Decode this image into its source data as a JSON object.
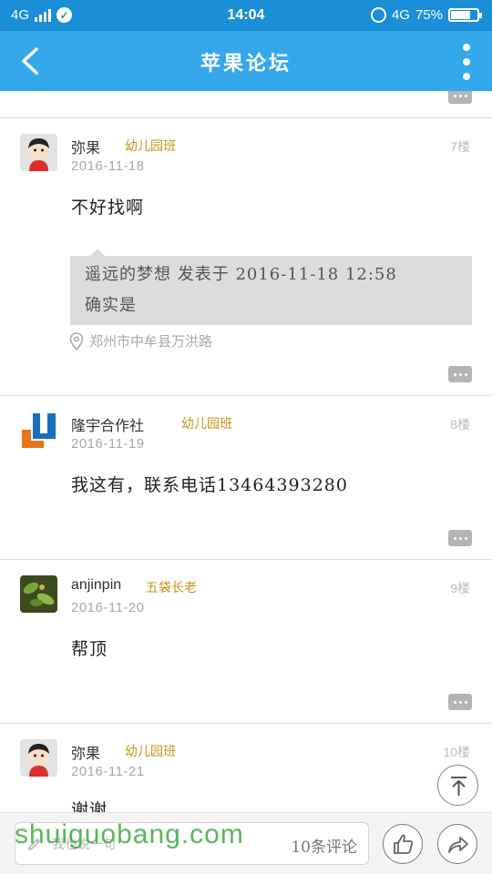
{
  "status_bar": {
    "network_left": "4G",
    "time": "14:04",
    "network_right": "4G",
    "battery_percent": "75%",
    "battery_level": 0.75
  },
  "header": {
    "title": "苹果论坛",
    "back_icon": "chevron-left-icon",
    "more_icon": "vertical-dots-icon"
  },
  "posts": [
    {
      "username": "弥果",
      "badge": "幼儿园班",
      "date": "2016-11-18",
      "floor": "7楼",
      "content": "不好找啊",
      "quote_line1": "遥远的梦想 发表于 2016-11-18 12:58",
      "quote_line2": "确实是",
      "location": "郑州市中牟县万洪路"
    },
    {
      "username": "隆宇合作社",
      "badge": "幼儿园班",
      "date": "2016-11-19",
      "floor": "8楼",
      "content": "我这有，联系电话13464393280"
    },
    {
      "username": "anjinpin",
      "badge": "五袋长老",
      "date": "2016-11-20",
      "floor": "9楼",
      "content": "帮顶"
    },
    {
      "username": "弥果",
      "badge": "幼儿园班",
      "date": "2016-11-21",
      "floor": "10楼",
      "content": "谢谢"
    }
  ],
  "bottom_bar": {
    "input_placeholder": "我也说一句",
    "comment_count": "10条评论",
    "like_icon": "thumbs-up-icon",
    "share_icon": "share-icon"
  },
  "watermark": "shuiguobang.com",
  "colors": {
    "status_bar": "#1a8fd8",
    "header": "#35a8ec",
    "badge": "#c8941a"
  }
}
